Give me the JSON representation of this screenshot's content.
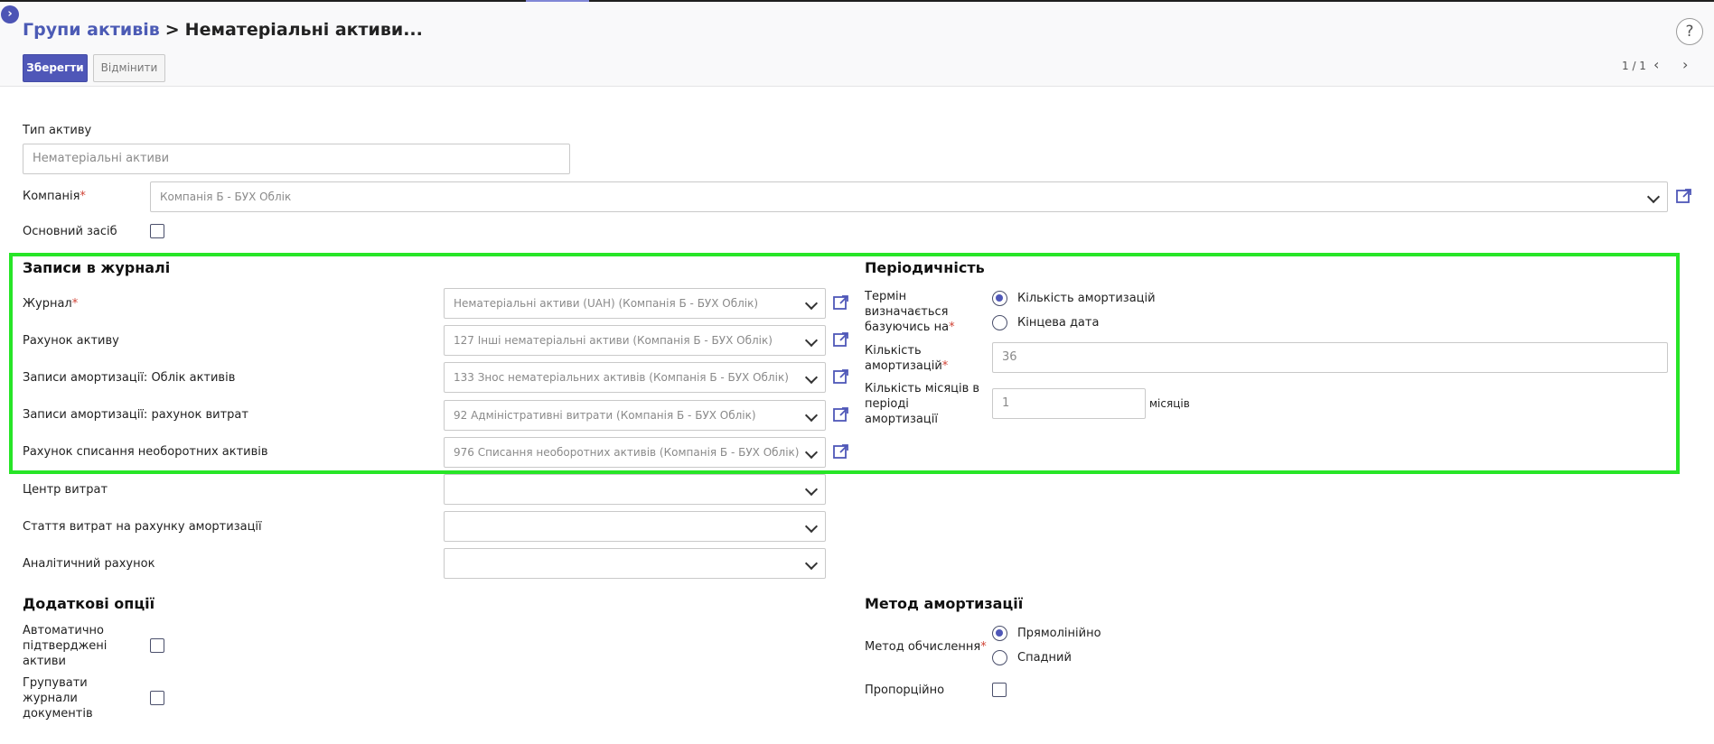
{
  "breadcrumb": {
    "parent": "Групи активів",
    "separator": ">",
    "current": "Нематеріальні активи..."
  },
  "help": "?",
  "toolbar": {
    "save_label": "Зберегти",
    "cancel_label": "Відмінити"
  },
  "pager": {
    "text": "1 / 1",
    "prev": "‹",
    "next": "›"
  },
  "form": {
    "asset_type_label": "Тип активу",
    "asset_type_value": "Нематеріальні активи",
    "company_label": "Компанія",
    "company_value": "Компанія Б - БУХ Облік",
    "fixed_asset_label": "Основний засіб",
    "required_mark": "*"
  },
  "journal_section": {
    "title": "Записи в журналі",
    "rows": [
      {
        "label": "Журнал",
        "value": "Нематеріальні активи (UAH) (Компанія Б - БУХ Облік)"
      },
      {
        "label": "Рахунок активу",
        "value": "127 Інші нематеріальні активи (Компанія Б - БУХ Облік)"
      },
      {
        "label": "Записи амортизації: Облік активів",
        "value": "133 Знос нематеріальних активів (Компанія Б - БУХ Облік)"
      },
      {
        "label": "Записи амортизації: рахунок витрат",
        "value": "92 Адміністративні витрати (Компанія Б - БУХ Облік)"
      },
      {
        "label": "Рахунок списання необоротних активів",
        "value": "976 Списання необоротних активів (Компанія Б - БУХ Облік)"
      },
      {
        "label": "Центр витрат",
        "value": ""
      },
      {
        "label": "Стаття витрат на рахунку амортизації",
        "value": ""
      },
      {
        "label": "Аналітичний рахунок",
        "value": ""
      }
    ]
  },
  "periodicity_section": {
    "title": "Періодичність",
    "term_label_1": "Термін",
    "term_label_2": "визначається",
    "term_label_3": "базуючись на",
    "term_options": [
      "Кількість амортизацій",
      "Кінцева дата"
    ],
    "count_label_1": "Кількість",
    "count_label_2": "амортизацій",
    "count_value": "36",
    "months_label_1": "Кількість місяців в",
    "months_label_2": "періоді",
    "months_label_3": "амортизації",
    "months_value": "1",
    "months_unit": "місяців"
  },
  "options_section": {
    "title": "Додаткові опції",
    "auto_confirm_1": "Автоматично",
    "auto_confirm_2": "підтверджені",
    "auto_confirm_3": "активи",
    "group_journal_1": "Групувати",
    "group_journal_2": "журнали",
    "group_journal_3": "документів"
  },
  "method_section": {
    "title": "Метод амортизації",
    "method_label": "Метод обчислення",
    "method_options": [
      "Прямолінійно",
      "Спадний"
    ],
    "prorata_label": "Пропорційно"
  },
  "colors": {
    "accent": "#4f57b8",
    "highlight": "#27e527",
    "required": "#d04437"
  }
}
